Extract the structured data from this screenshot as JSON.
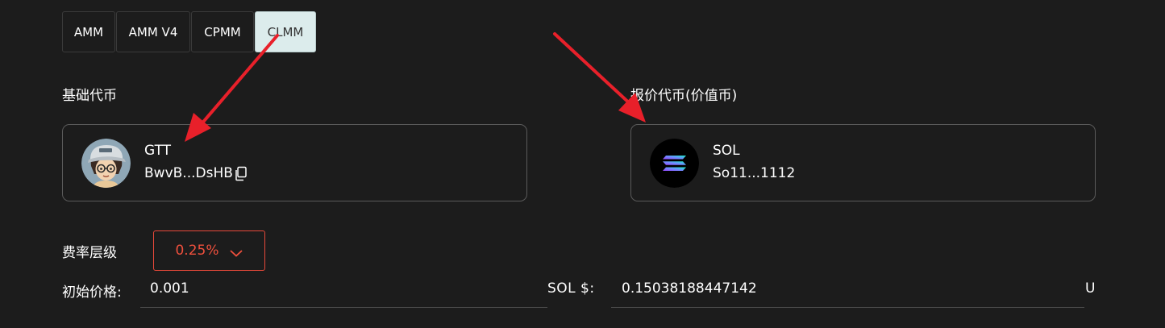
{
  "pool_types": {
    "tabs": [
      {
        "label": "AMM",
        "active": false
      },
      {
        "label": "AMM V4",
        "active": false
      },
      {
        "label": "CPMM",
        "active": false
      },
      {
        "label": "CLMM",
        "active": true
      }
    ]
  },
  "base_token": {
    "section_label": "基础代币",
    "symbol": "GTT",
    "address": "BwvB...DsHB",
    "avatar_icon": "cartoon-avatar-icon"
  },
  "quote_token": {
    "section_label": "报价代币(价值币)",
    "symbol": "SOL",
    "address": "So11...1112",
    "logo_icon": "solana-logo-icon"
  },
  "fee_tier": {
    "label": "费率层级",
    "value": "0.25%"
  },
  "initial_price": {
    "label": "初始价格:",
    "value": "0.001"
  },
  "sol_price": {
    "label": "SOL $:",
    "value": "0.15038188447142",
    "suffix": "U"
  },
  "colors": {
    "background": "#1c1c1c",
    "active_tab": "#dcecec",
    "fee_accent": "#f0503d",
    "annotation_arrow": "#e8202a"
  }
}
